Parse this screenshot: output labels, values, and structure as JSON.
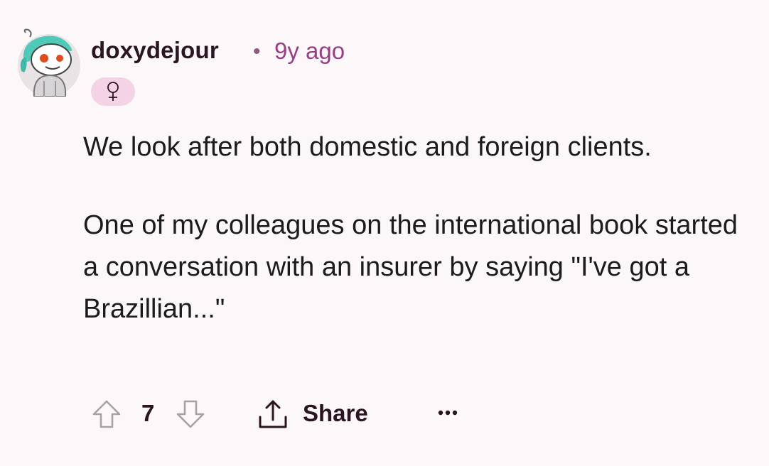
{
  "comment": {
    "username": "doxydejour",
    "separator": "•",
    "age": "9y ago",
    "flair_icon": "female-symbol-icon",
    "paragraphs": [
      "We look after both domestic and foreign clients.",
      "One of my colleagues on the international book started a conversation with an insurer by saying \"I've got a Brazillian...\""
    ]
  },
  "actions": {
    "upvote_icon": "upvote-arrow-icon",
    "score": "7",
    "downvote_icon": "downvote-arrow-icon",
    "share_icon": "share-icon",
    "share_label": "Share",
    "more_icon": "more-options-icon"
  },
  "colors": {
    "background": "#fcf8fa",
    "username": "#2a1520",
    "age": "#9a3d86",
    "flair_bg": "#f5d3e6",
    "icon_gray": "#a8a2a6"
  }
}
